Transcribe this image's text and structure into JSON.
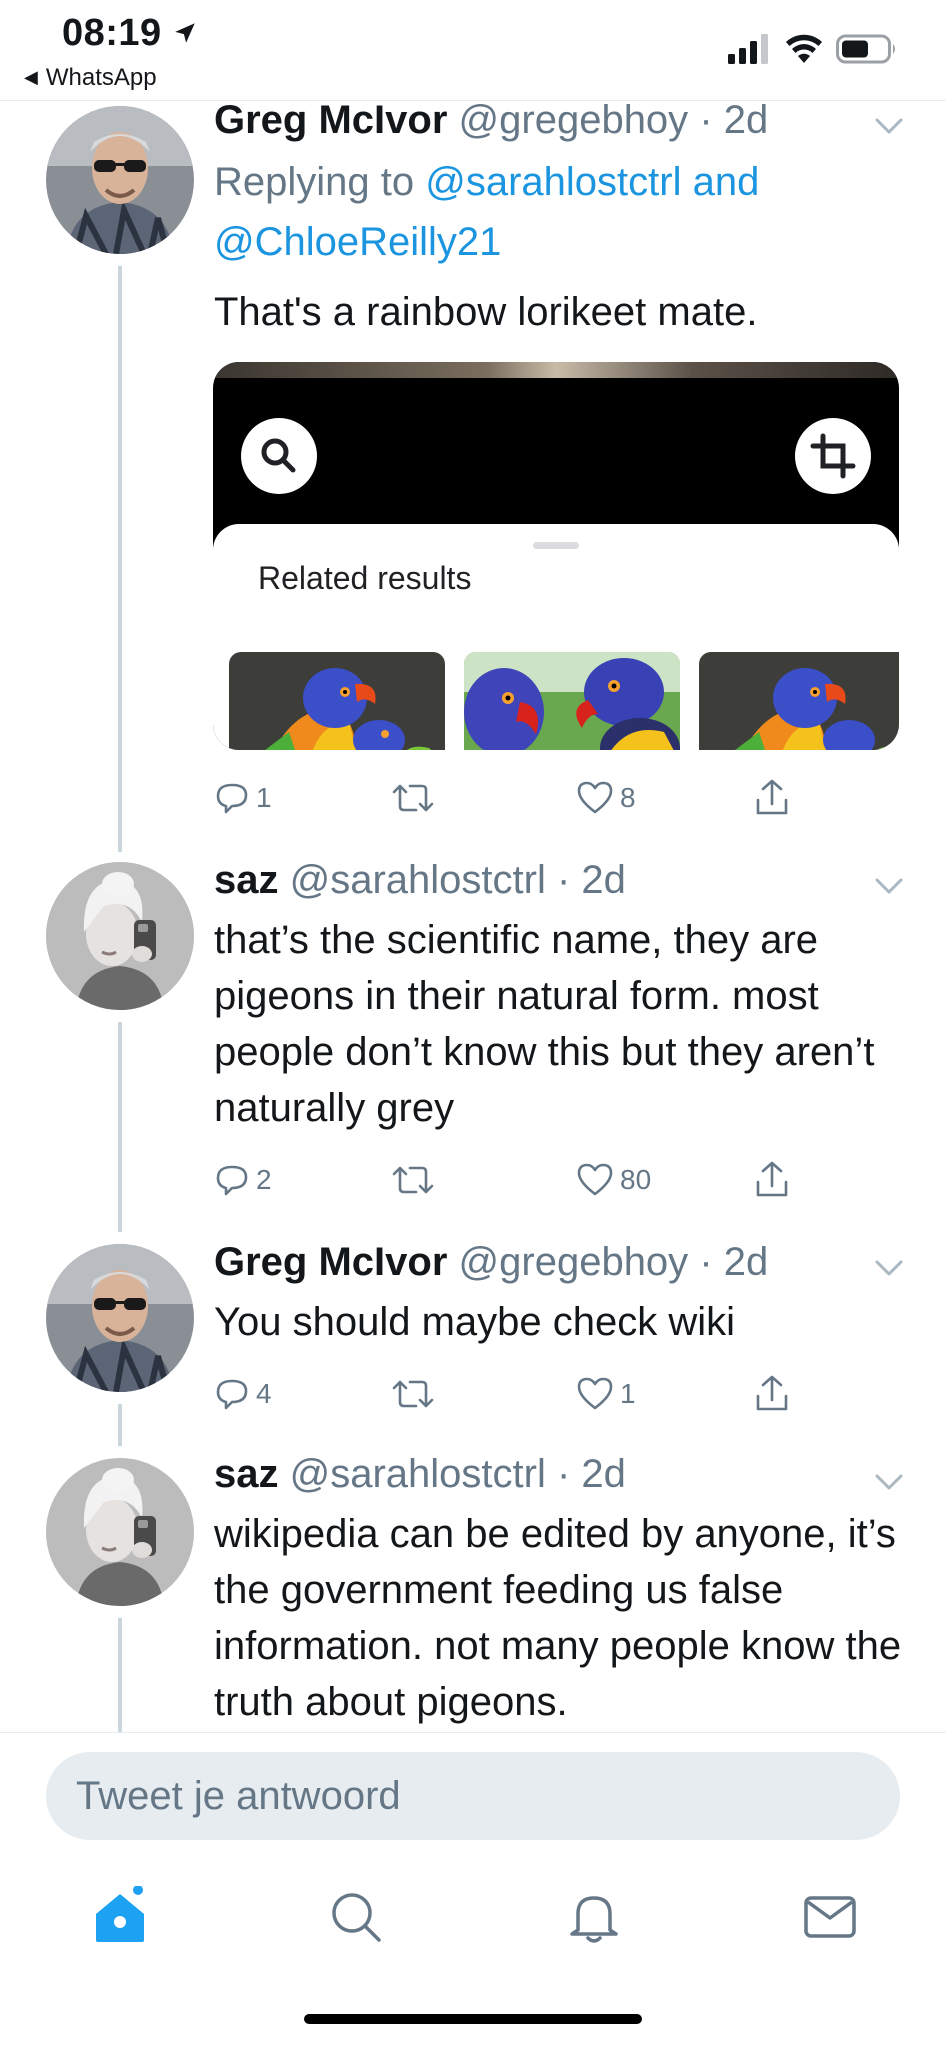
{
  "status_bar": {
    "time": "08:19",
    "back_app": "WhatsApp",
    "location_icon": "location-arrow-icon",
    "signal_icon": "cellular-signal-icon",
    "wifi_icon": "wifi-icon",
    "battery_icon": "battery-icon"
  },
  "tweets": [
    {
      "name": "Greg McIvor",
      "handle": "@gregebhoy",
      "time": "· 2d",
      "replying_prefix": "Replying to ",
      "replying_user1": "@sarahlostctrl",
      "replying_and": " and",
      "replying_user2": "@ChloeReilly21",
      "text": "That's a rainbow lorikeet mate.",
      "media": {
        "related_title": "Related results",
        "search_icon": "search-icon",
        "crop_icon": "crop-icon"
      },
      "replies": "1",
      "retweets": "",
      "likes": "8"
    },
    {
      "name": "saz",
      "handle": "@sarahlostctrl",
      "time": "· 2d",
      "text": "that’s the scientific name, they are pigeons in their natural form. most people don’t know this but they aren’t naturally grey",
      "replies": "2",
      "retweets": "",
      "likes": "80"
    },
    {
      "name": "Greg McIvor",
      "handle": "@gregebhoy",
      "time": "· 2d",
      "text": "You should maybe check wiki",
      "replies": "4",
      "retweets": "",
      "likes": "1"
    },
    {
      "name": "saz",
      "handle": "@sarahlostctrl",
      "time": "· 2d",
      "text": "wikipedia can be edited by anyone, it’s the government feeding us false information. not many people know the truth about pigeons."
    }
  ],
  "reply_bar": {
    "placeholder": "Tweet je antwoord"
  },
  "tab_bar": {
    "items": [
      "home-icon",
      "search-icon",
      "notifications-icon",
      "messages-icon"
    ]
  },
  "colors": {
    "accent": "#1da1f2",
    "link": "#1b95e0",
    "text": "#14171a",
    "secondary": "#657786",
    "divider": "#e6ecf0"
  }
}
